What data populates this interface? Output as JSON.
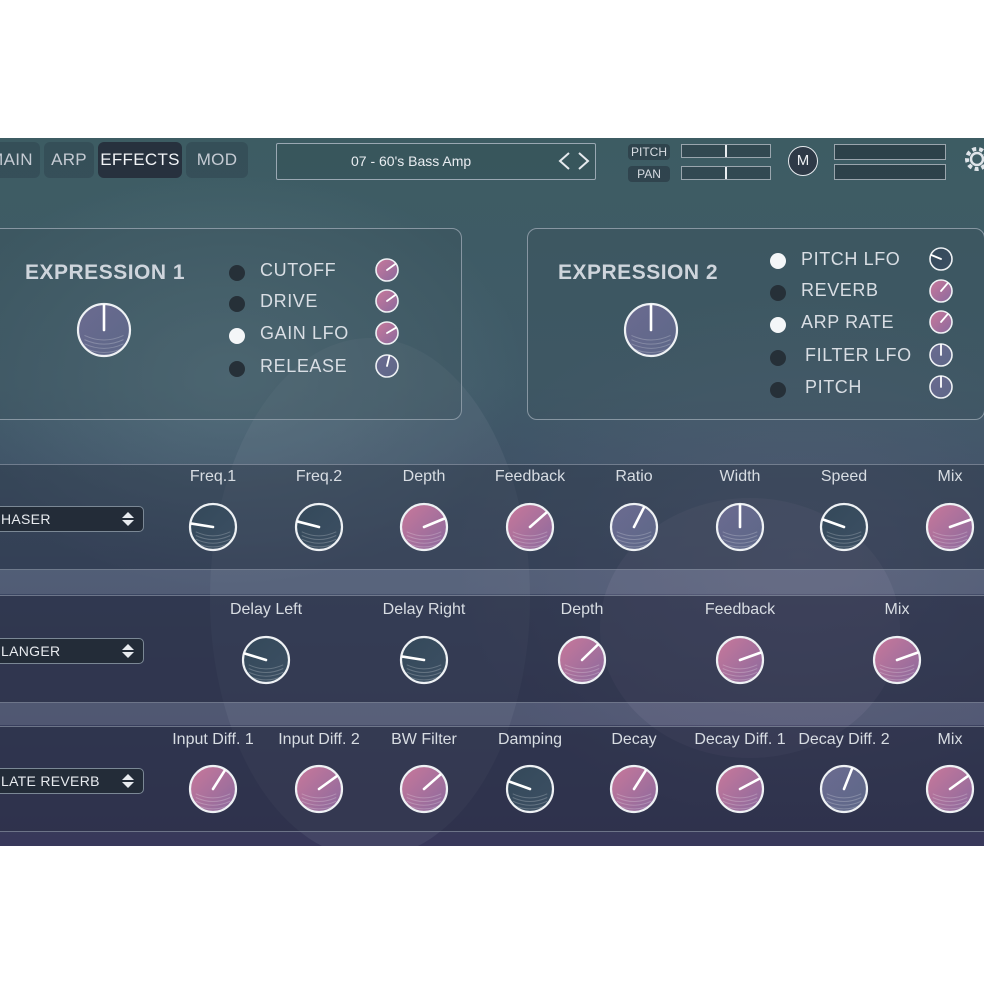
{
  "tabs": [
    {
      "label": "MAIN",
      "active": false
    },
    {
      "label": "ARP",
      "active": false
    },
    {
      "label": "EFFECTS",
      "active": true
    },
    {
      "label": "MOD",
      "active": false
    }
  ],
  "preset": {
    "name": "07 - 60's Bass Amp"
  },
  "pitch_label": "PITCH",
  "pan_label": "PAN",
  "m_button": "M",
  "expression1": {
    "title": "EXPRESSION 1",
    "targets": [
      {
        "label": "CUTOFF",
        "on": false,
        "amount": 0.7
      },
      {
        "label": "DRIVE",
        "on": false,
        "amount": 0.7
      },
      {
        "label": "GAIN LFO",
        "on": true,
        "amount": 0.72
      },
      {
        "label": "RELEASE",
        "on": false,
        "amount": 0.55
      }
    ]
  },
  "expression2": {
    "title": "EXPRESSION 2",
    "targets": [
      {
        "label": "PITCH LFO",
        "on": true,
        "amount": 0.25
      },
      {
        "label": "REVERB",
        "on": false,
        "amount": 0.65
      },
      {
        "label": "ARP RATE",
        "on": true,
        "amount": 0.65
      },
      {
        "label": "FILTER LFO",
        "on": false,
        "amount": 0.5
      },
      {
        "label": "PITCH",
        "on": false,
        "amount": 0.5
      }
    ]
  },
  "effects": [
    {
      "name": "HASER",
      "params": [
        {
          "label": "Freq.1",
          "value": 0.2
        },
        {
          "label": "Freq.2",
          "value": 0.22
        },
        {
          "label": "Depth",
          "value": 0.75
        },
        {
          "label": "Feedback",
          "value": 0.68
        },
        {
          "label": "Ratio",
          "value": 0.6
        },
        {
          "label": "Width",
          "value": 0.5
        },
        {
          "label": "Speed",
          "value": 0.24
        },
        {
          "label": "Mix",
          "value": 0.76
        }
      ]
    },
    {
      "name": "LANGER",
      "params": [
        {
          "label": "Delay Left",
          "value": 0.23
        },
        {
          "label": "Delay Right",
          "value": 0.2
        },
        {
          "label": "Depth",
          "value": 0.67
        },
        {
          "label": "Feedback",
          "value": 0.76
        },
        {
          "label": "Mix",
          "value": 0.76
        }
      ]
    },
    {
      "name": "LATE REVERB",
      "params": [
        {
          "label": "Input Diff. 1",
          "value": 0.62
        },
        {
          "label": "Input Diff. 2",
          "value": 0.7
        },
        {
          "label": "BW Filter",
          "value": 0.68
        },
        {
          "label": "Damping",
          "value": 0.24
        },
        {
          "label": "Decay",
          "value": 0.62
        },
        {
          "label": "Decay Diff. 1",
          "value": 0.73
        },
        {
          "label": "Decay Diff. 2",
          "value": 0.58
        },
        {
          "label": "Mix",
          "value": 0.7
        }
      ]
    }
  ]
}
